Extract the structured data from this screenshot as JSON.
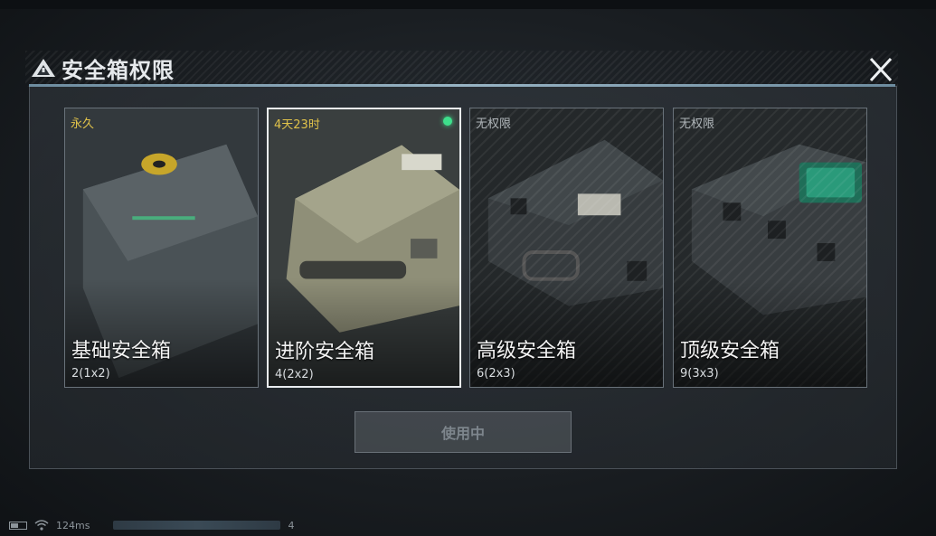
{
  "title": "安全箱权限",
  "icons": {
    "title": "warning-triangle-icon",
    "close": "close-icon",
    "battery": "battery-icon",
    "wifi": "wifi-icon"
  },
  "cards": [
    {
      "duration": "永久",
      "name": "基础安全箱",
      "capacity": "2(1x2)",
      "selected": false,
      "active": false,
      "tone": "#3c4346"
    },
    {
      "duration": "4天23时",
      "name": "进阶安全箱",
      "capacity": "4(2x2)",
      "selected": true,
      "active": true,
      "tone": "#7a7b64"
    },
    {
      "duration": "无权限",
      "name": "高级安全箱",
      "capacity": "6(2x3)",
      "selected": false,
      "active": false,
      "tone": "#2d3235"
    },
    {
      "duration": "无权限",
      "name": "顶级安全箱",
      "capacity": "9(3x3)",
      "selected": false,
      "active": false,
      "tone": "#2f3436"
    }
  ],
  "action_button": {
    "label": "使用中",
    "enabled": false
  },
  "status": {
    "ping": "124ms",
    "extra": "4"
  },
  "colors": {
    "accent_line": "#98b4c4",
    "duration_yellow": "#e0c24a",
    "active_green": "#3ee08c"
  }
}
